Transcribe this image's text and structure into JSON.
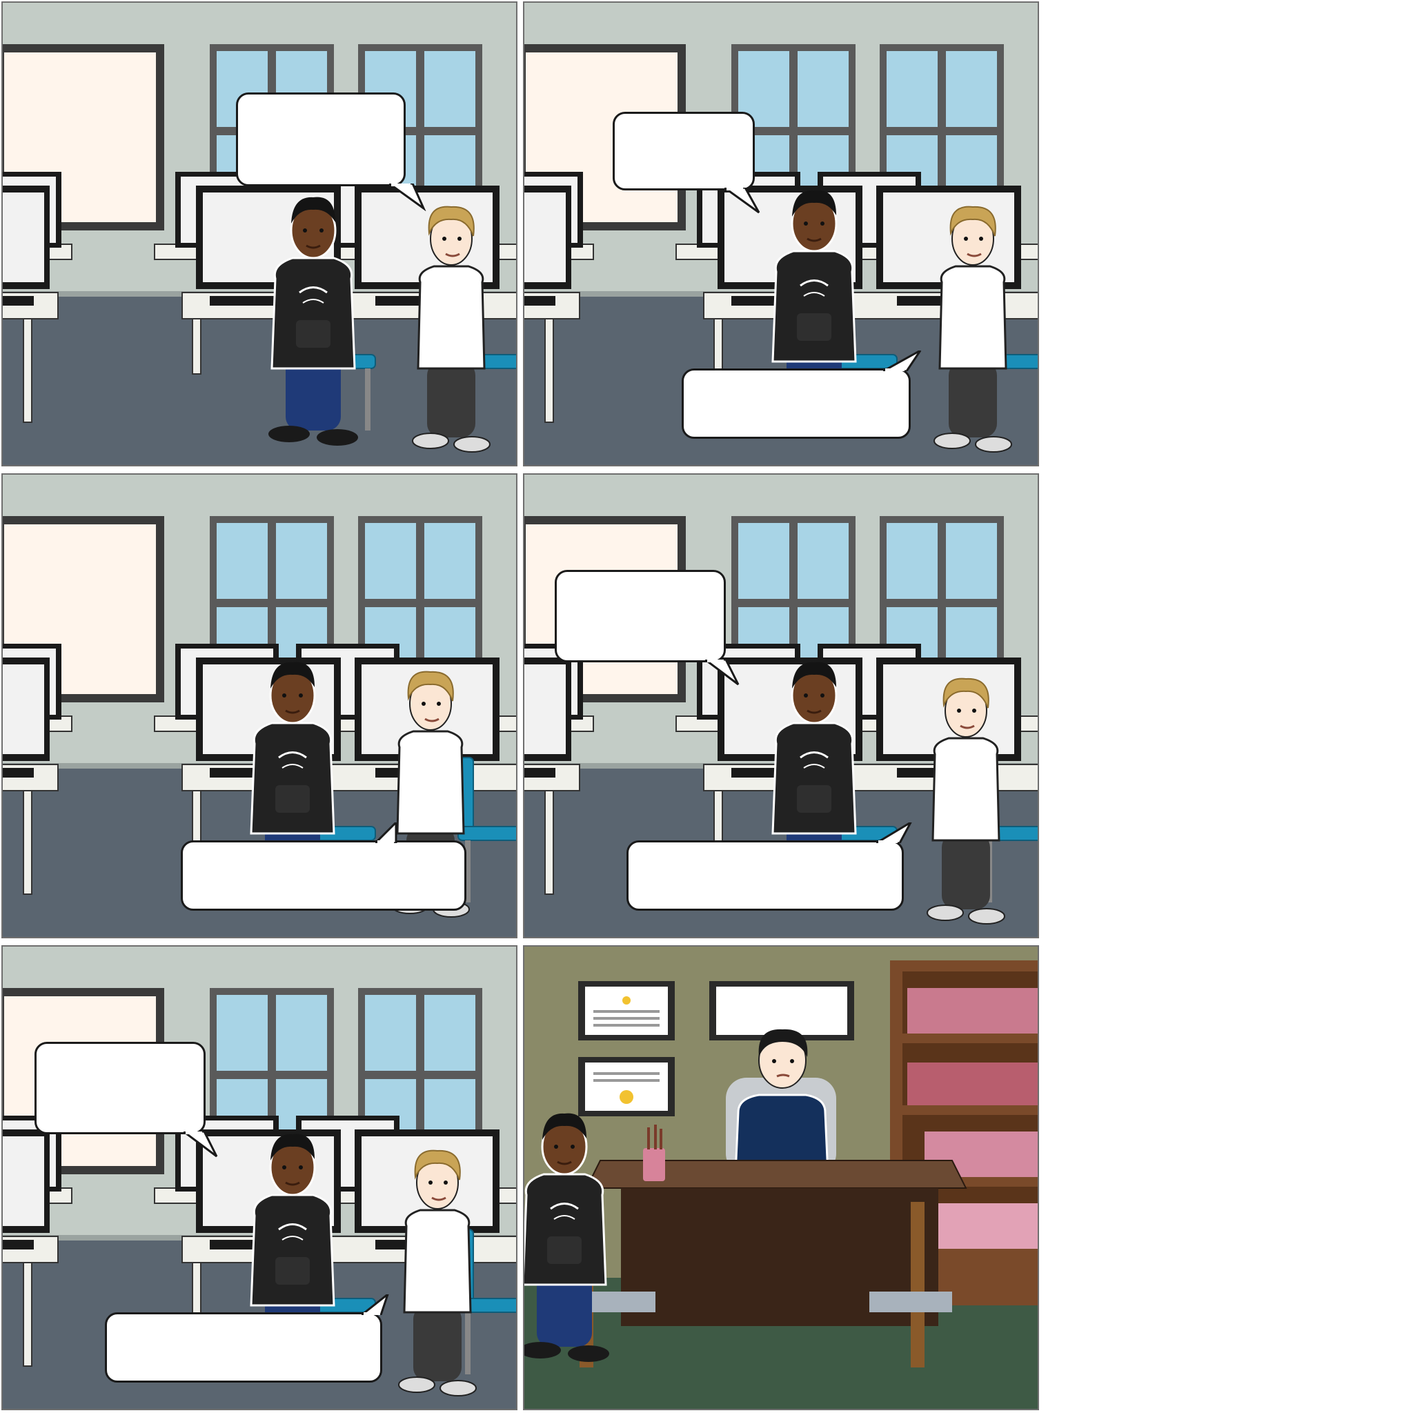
{
  "storyboard": {
    "panels": [
      {
        "scene": "classroom",
        "bubbles": [
          {
            "text": ""
          }
        ]
      },
      {
        "scene": "classroom",
        "bubbles": [
          {
            "text": ""
          },
          {
            "text": ""
          }
        ]
      },
      {
        "scene": "classroom",
        "bubbles": [
          {
            "text": ""
          }
        ]
      },
      {
        "scene": "classroom",
        "bubbles": [
          {
            "text": ""
          },
          {
            "text": ""
          }
        ]
      },
      {
        "scene": "classroom",
        "bubbles": [
          {
            "text": ""
          },
          {
            "text": ""
          }
        ]
      },
      {
        "scene": "principal-office",
        "bubbles": [],
        "sign_text": ""
      }
    ]
  },
  "colors": {
    "wall": "#c3ccc6",
    "floor": "#5a6570",
    "window_glass": "#a8d4e6",
    "whiteboard": "#fff5ec",
    "chair_blue": "#1a8fb8",
    "office_wall": "#8a8a68",
    "office_floor": "#3e5a45",
    "desk_wood": "#6b4a33",
    "bookshelf": "#7a4a2a",
    "books_pink": "#c97a8e"
  },
  "icons": [
    "student-dark-hoodie",
    "student-blond-tshirt",
    "principal",
    "computer-monitor",
    "bookshelf",
    "certificate"
  ]
}
